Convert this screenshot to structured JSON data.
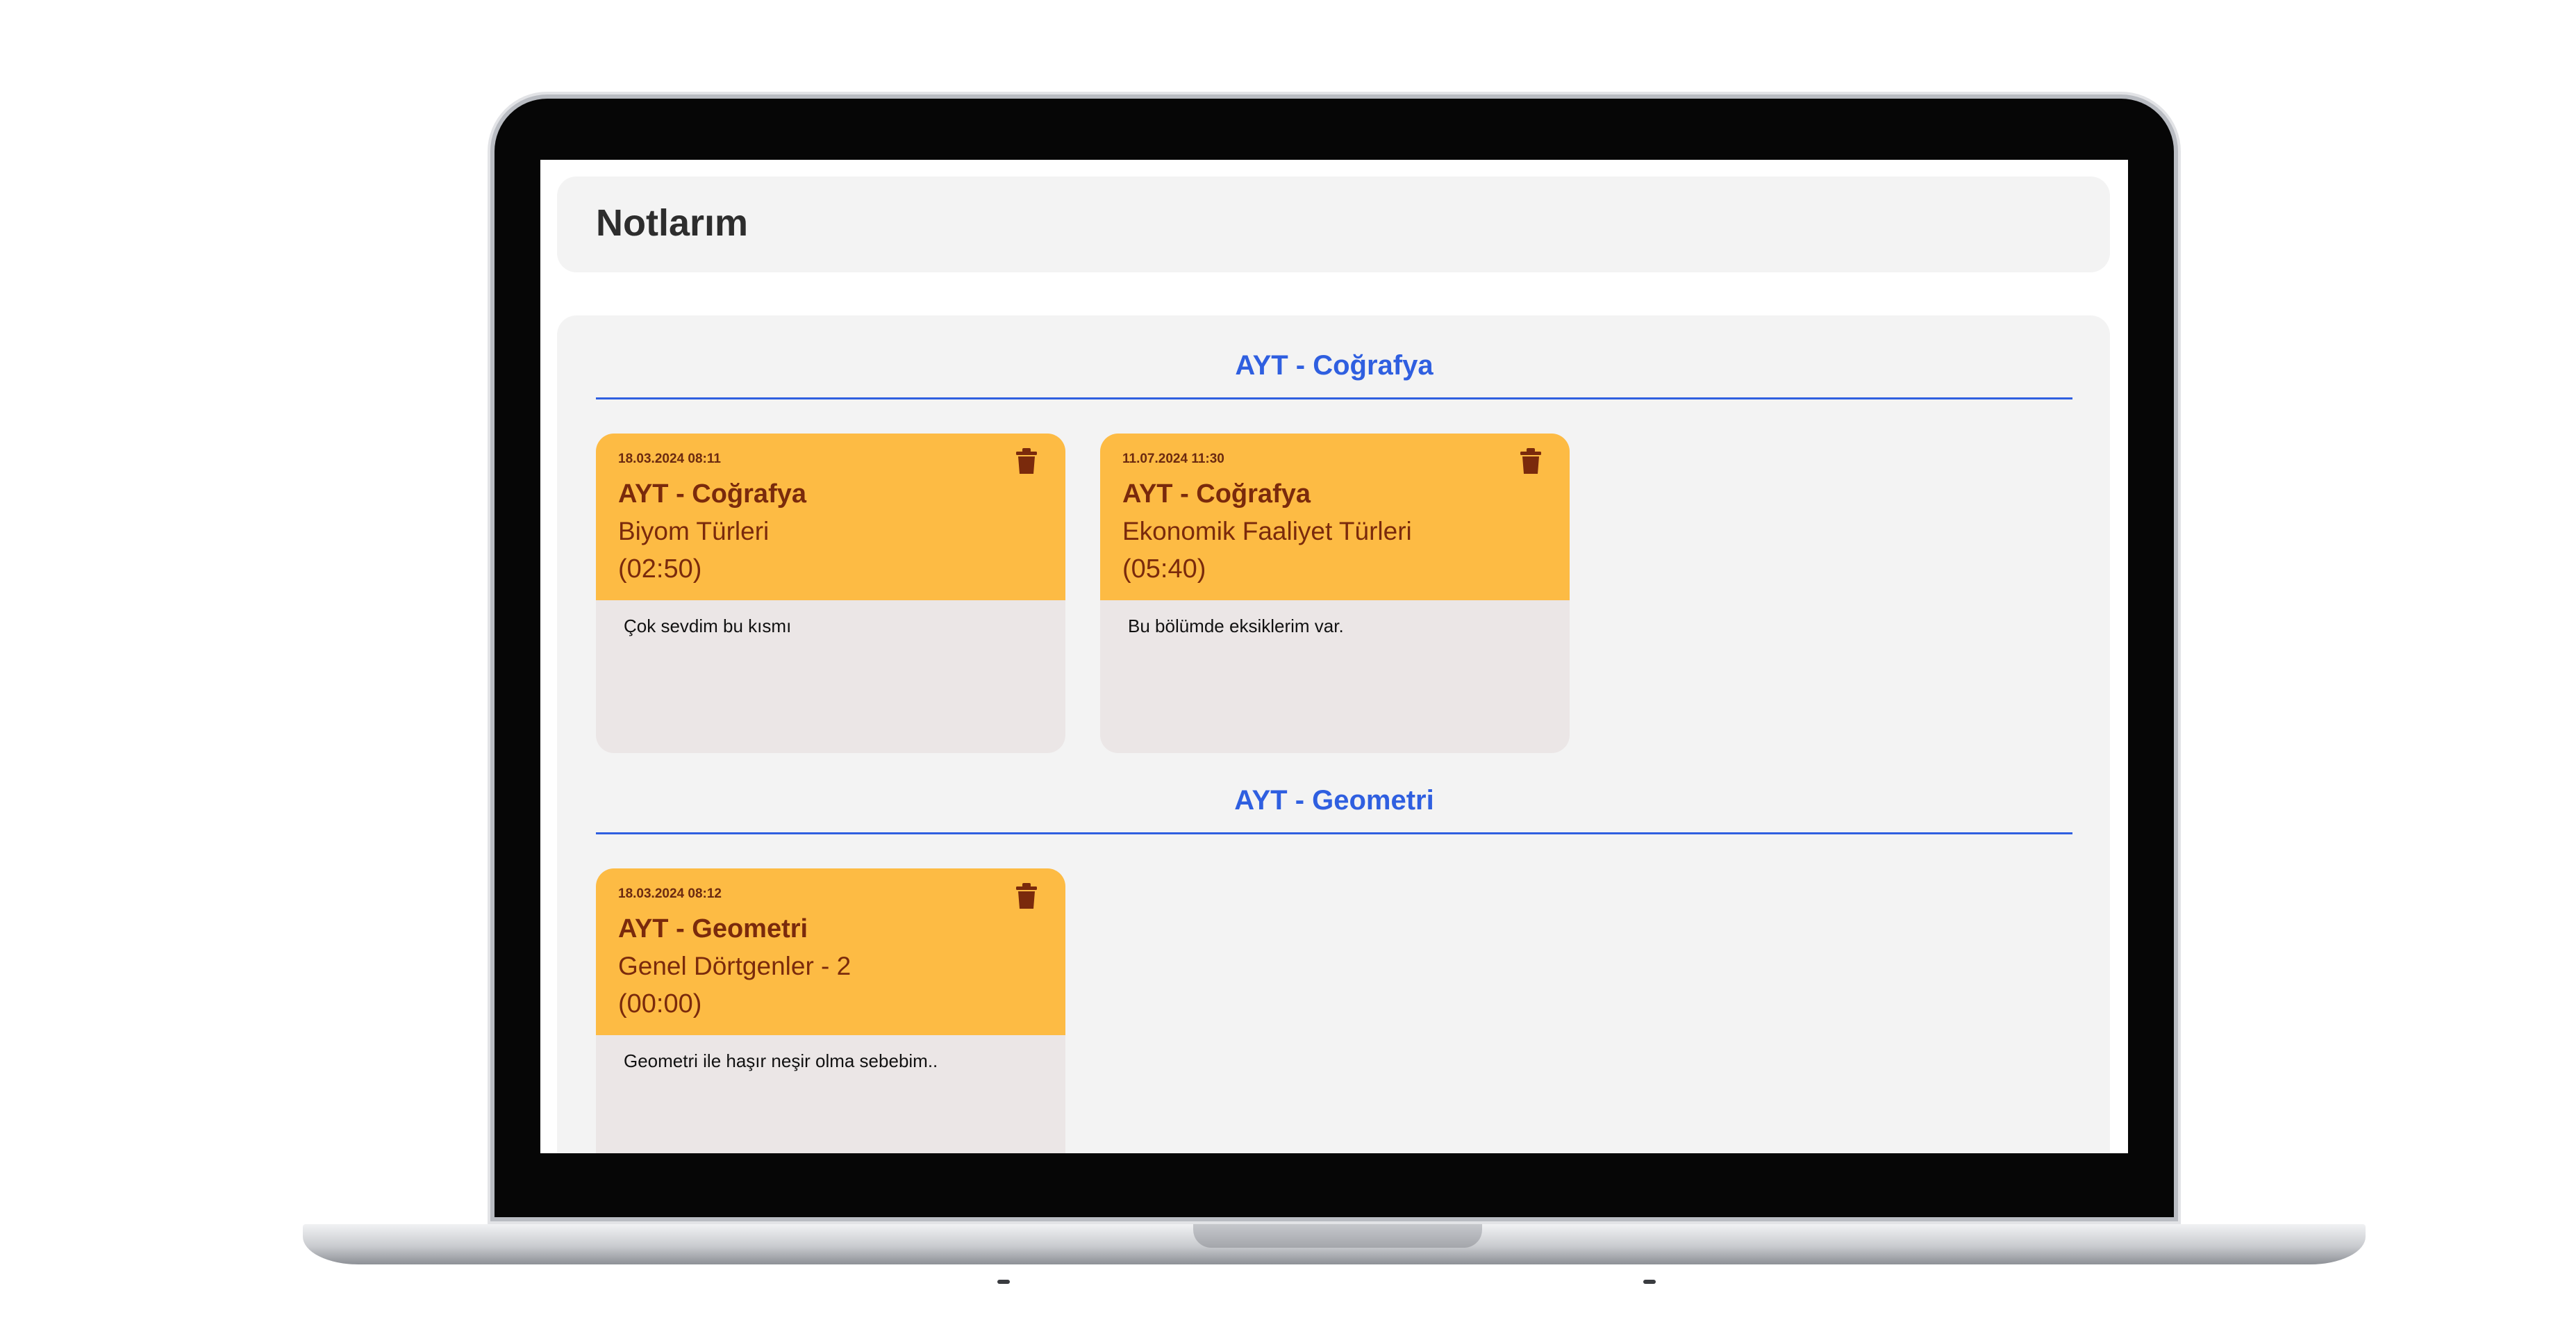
{
  "page": {
    "title": "Notlarım"
  },
  "sections": [
    {
      "title": "AYT - Coğrafya",
      "notes": [
        {
          "date": "18.03.2024 08:11",
          "course": "AYT - Coğrafya",
          "topic": "Biyom Türleri",
          "time": "(02:50)",
          "text": "Çok sevdim bu kısmı"
        },
        {
          "date": "11.07.2024 11:30",
          "course": "AYT - Coğrafya",
          "topic": "Ekonomik Faaliyet Türleri",
          "time": "(05:40)",
          "text": "Bu bölümde eksiklerim var."
        }
      ]
    },
    {
      "title": "AYT - Geometri",
      "notes": [
        {
          "date": "18.03.2024 08:12",
          "course": "AYT - Geometri",
          "topic": "Genel Dörtgenler - 2",
          "time": "(00:00)",
          "text": "Geometri ile haşır neşir olma sebebim.."
        }
      ]
    }
  ],
  "icons": {
    "delete": "trash-icon"
  },
  "colors": {
    "accent": "#2f5fe0",
    "card_header": "#fdbb44",
    "card_text": "#7a2a0c",
    "card_body": "#ebe6e6",
    "panel": "#f3f3f3"
  }
}
